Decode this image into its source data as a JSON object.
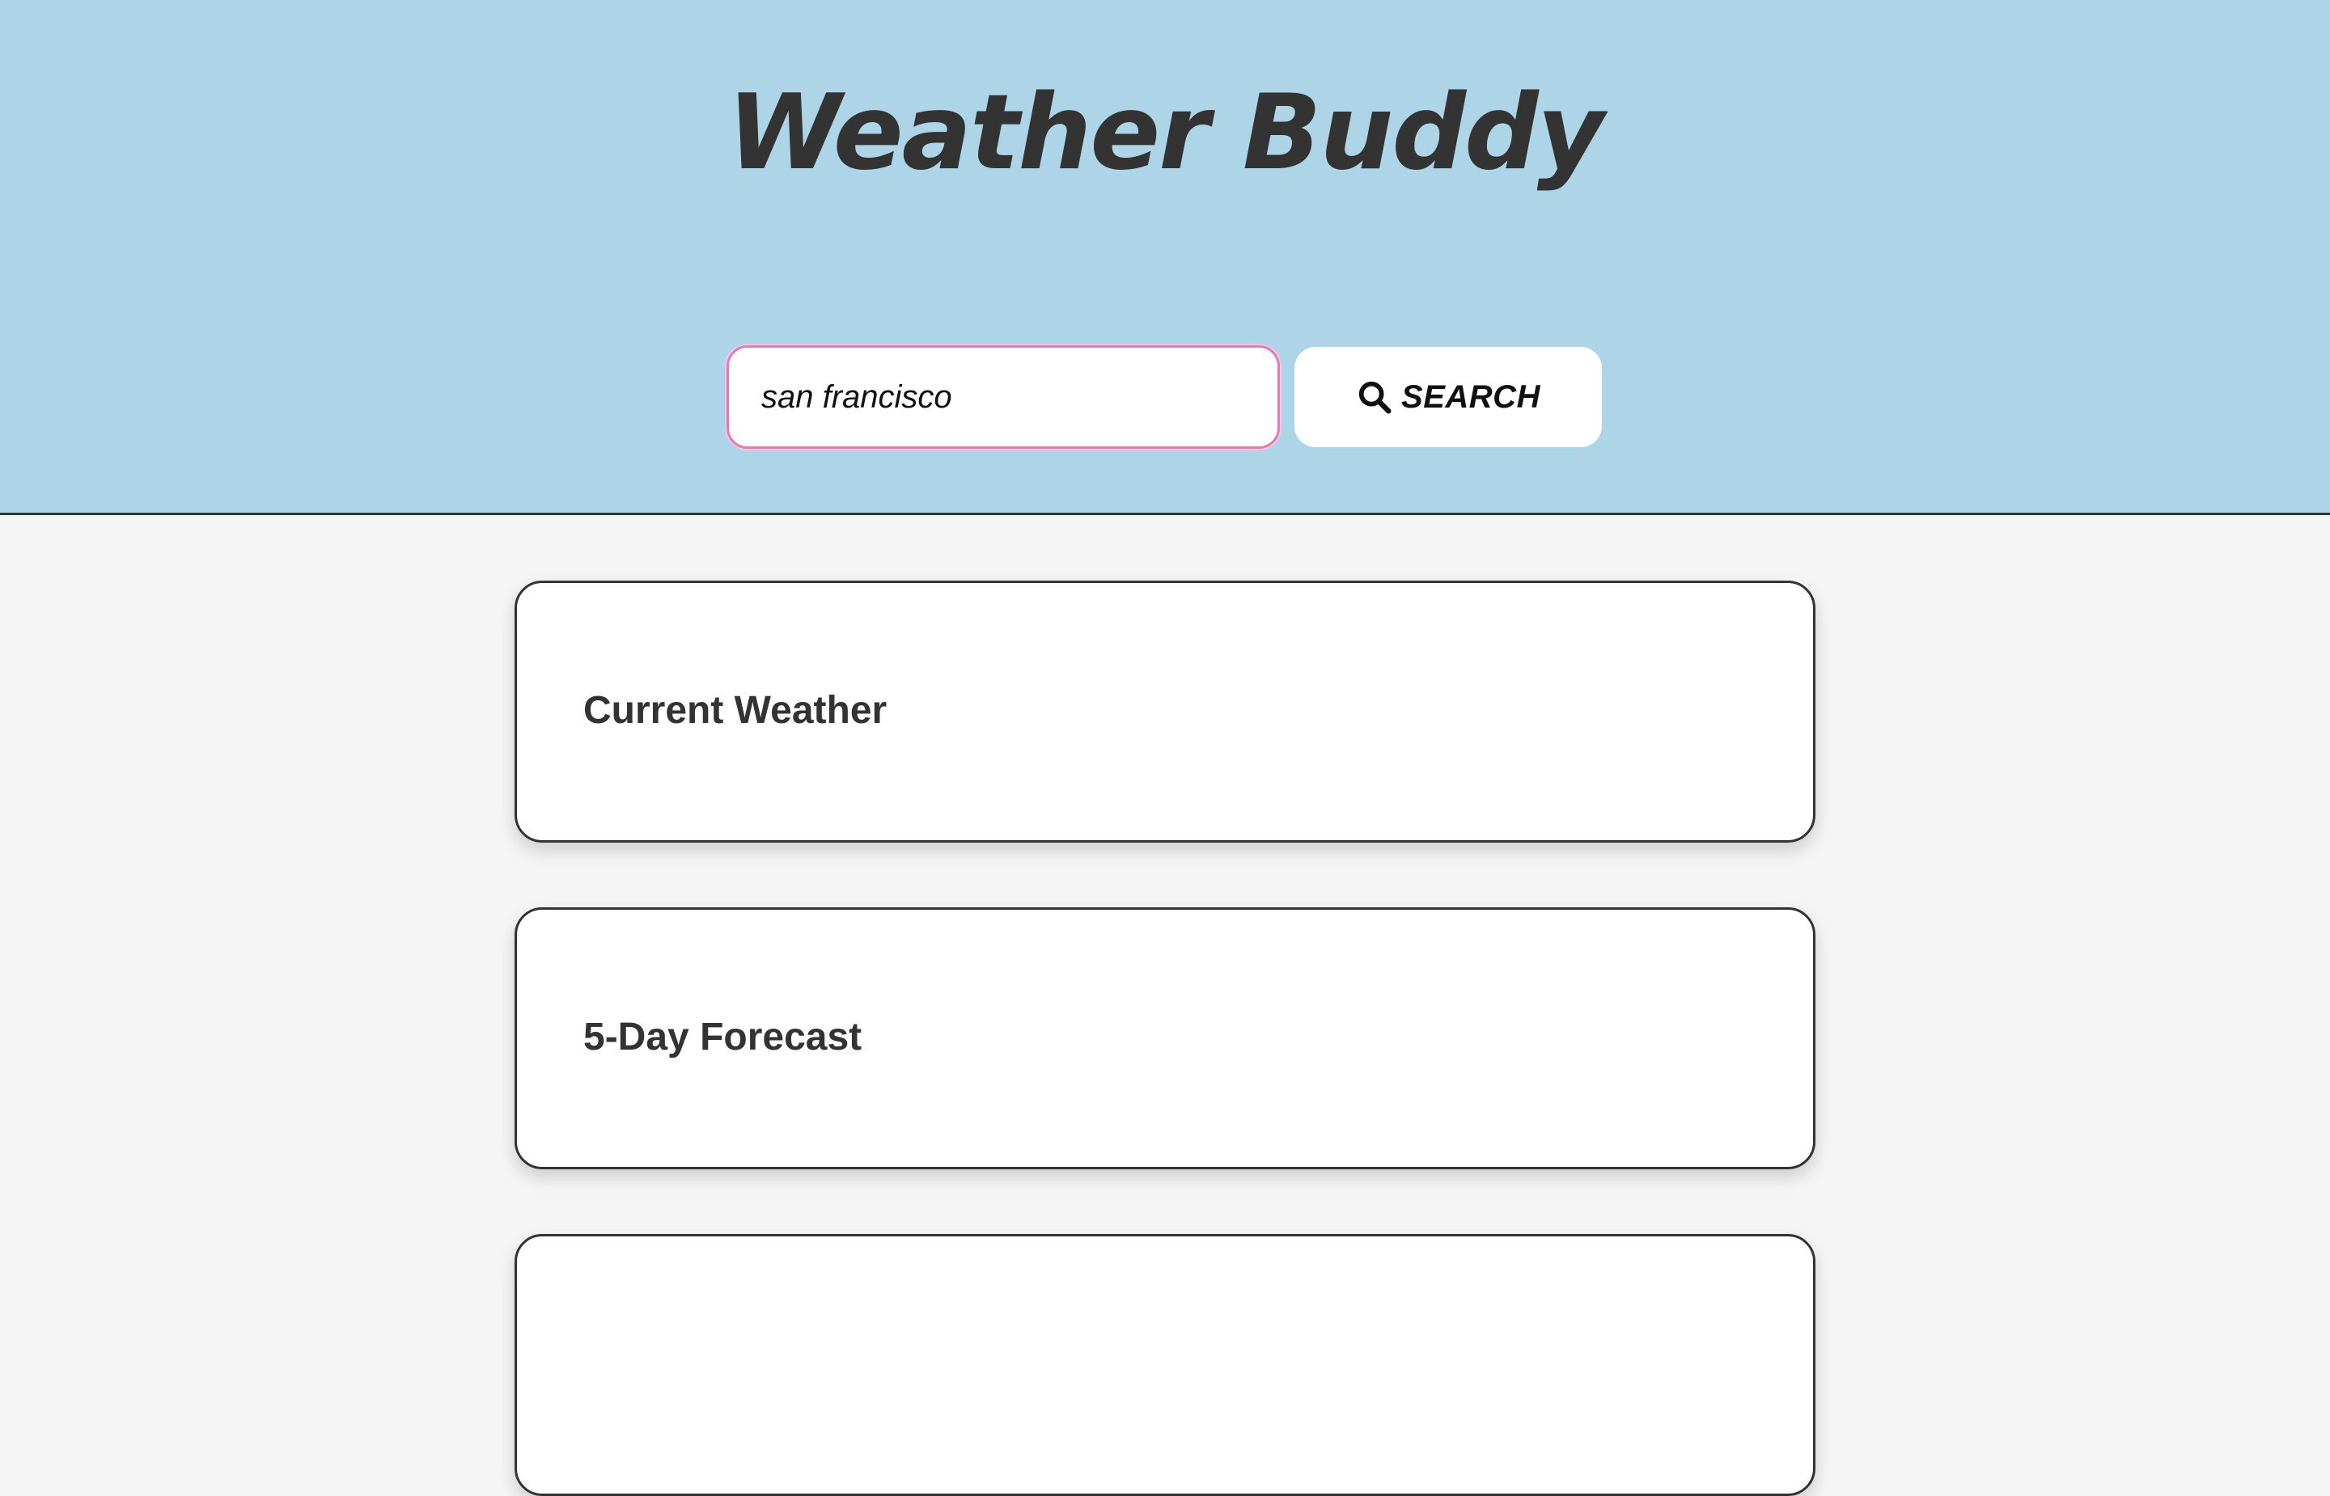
{
  "header": {
    "title": "Weather Buddy",
    "background_color": "#aed4e8"
  },
  "search": {
    "value": "san francisco",
    "placeholder": "",
    "button_label": "SEARCH",
    "button_icon": "search-icon",
    "focus_color": "#e07db5"
  },
  "sections": {
    "current": {
      "title": "Current Weather"
    },
    "forecast": {
      "title": "5-Day Forecast"
    },
    "third": {
      "title": ""
    }
  }
}
